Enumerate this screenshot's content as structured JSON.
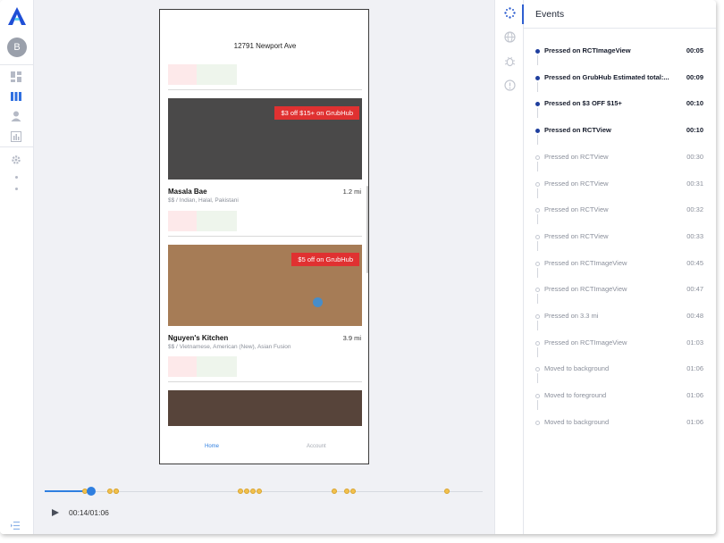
{
  "sidebar": {
    "avatar_initial": "B"
  },
  "phone": {
    "address": "12791 Newport Ave",
    "restaurants": [
      {
        "promo": "$3 off $15+ on GrubHub",
        "name": "Masala Bae",
        "distance": "1.2 mi",
        "subtitle": "$$ / Indian, Halal, Pakistani",
        "image_color": "#4a4949"
      },
      {
        "promo": "$5 off on GrubHub",
        "name": "Nguyen's Kitchen",
        "distance": "3.9 mi",
        "subtitle": "$$ / Vietnamese, American (New), Asian Fusion",
        "image_color": "#a67c56"
      },
      {
        "image_color": "#57443a"
      }
    ],
    "tabs": {
      "home": "Home",
      "account": "Account"
    }
  },
  "player": {
    "timecode": "00:14/01:06",
    "progress_fraction": 0.212,
    "marker_seconds": [
      5,
      9,
      10,
      10,
      30,
      31,
      32,
      33,
      45,
      47,
      48,
      63
    ]
  },
  "events": {
    "title": "Events",
    "items": [
      {
        "label": "Pressed on RCTImageView",
        "time": "00:05",
        "active": true
      },
      {
        "label": "Pressed on GrubHub Estimated total:...",
        "time": "00:09",
        "active": true
      },
      {
        "label": "Pressed on $3 OFF $15+",
        "time": "00:10",
        "active": true
      },
      {
        "label": "Pressed on RCTView",
        "time": "00:10",
        "active": true
      },
      {
        "label": "Pressed on RCTView",
        "time": "00:30",
        "active": false
      },
      {
        "label": "Pressed on RCTView",
        "time": "00:31",
        "active": false
      },
      {
        "label": "Pressed on RCTView",
        "time": "00:32",
        "active": false
      },
      {
        "label": "Pressed on RCTView",
        "time": "00:33",
        "active": false
      },
      {
        "label": "Pressed on RCTImageView",
        "time": "00:45",
        "active": false
      },
      {
        "label": "Pressed on RCTImageView",
        "time": "00:47",
        "active": false
      },
      {
        "label": "Pressed on 3.3 mi",
        "time": "00:48",
        "active": false
      },
      {
        "label": "Pressed on RCTImageView",
        "time": "01:03",
        "active": false
      },
      {
        "label": "Moved to background",
        "time": "01:06",
        "active": false
      },
      {
        "label": "Moved to foreground",
        "time": "01:06",
        "active": false
      },
      {
        "label": "Moved to background",
        "time": "01:06",
        "active": false
      }
    ]
  },
  "colors": {
    "accent": "#2f7fe0",
    "brand": "#1f3f9e",
    "promo": "#e03131",
    "marker": "#f2c14e"
  },
  "icons": {
    "leftnav": [
      "dashboard-icon",
      "sessions-icon",
      "user-icon",
      "chart-icon",
      "settings-icon"
    ],
    "rail": [
      "events-icon",
      "network-icon",
      "bug-icon",
      "info-icon"
    ]
  }
}
